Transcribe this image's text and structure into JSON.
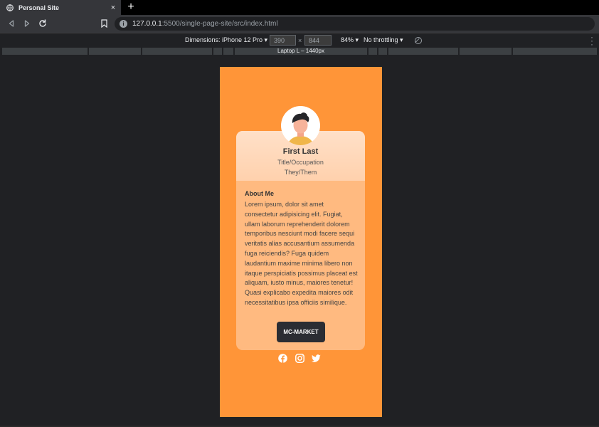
{
  "browser": {
    "tab_title": "Personal Site",
    "tab_close": "×",
    "new_tab": "+",
    "url_host": "127.0.0.1",
    "url_rest": ":5500/single-page-site/src/index.html"
  },
  "devtools": {
    "dimensions_label": "Dimensions: iPhone 12 Pro ▾",
    "width_value": "390",
    "height_value": "844",
    "times": "×",
    "zoom": "84% ▾",
    "throttle": "No throttling ▾",
    "media_label": "Laptop L – 1440px"
  },
  "profile": {
    "name": "First Last",
    "title": "Title/Occupation",
    "pronouns": "They/Them",
    "about_heading": "About Me",
    "about_text": "Lorem ipsum, dolor sit amet consectetur adipisicing elit. Fugiat, ullam laborum reprehenderit dolorem temporibus nesciunt modi facere sequi veritatis alias accusantium assumenda fuga reiciendis? Fuga quidem laudantium maxime minima libero non itaque perspiciatis possimus placeat est aliquam, iusto minus, maiores tenetur! Quasi explicabo expedita maiores odit necessitatibus ipsa officiis similique.",
    "button_label": "MC-MARKET"
  },
  "social": [
    "facebook-icon",
    "instagram-icon",
    "twitter-icon"
  ],
  "colors": {
    "page_bg": "#ff9538",
    "card_bg": "#ffba80",
    "button_bg": "#2b2d33"
  }
}
